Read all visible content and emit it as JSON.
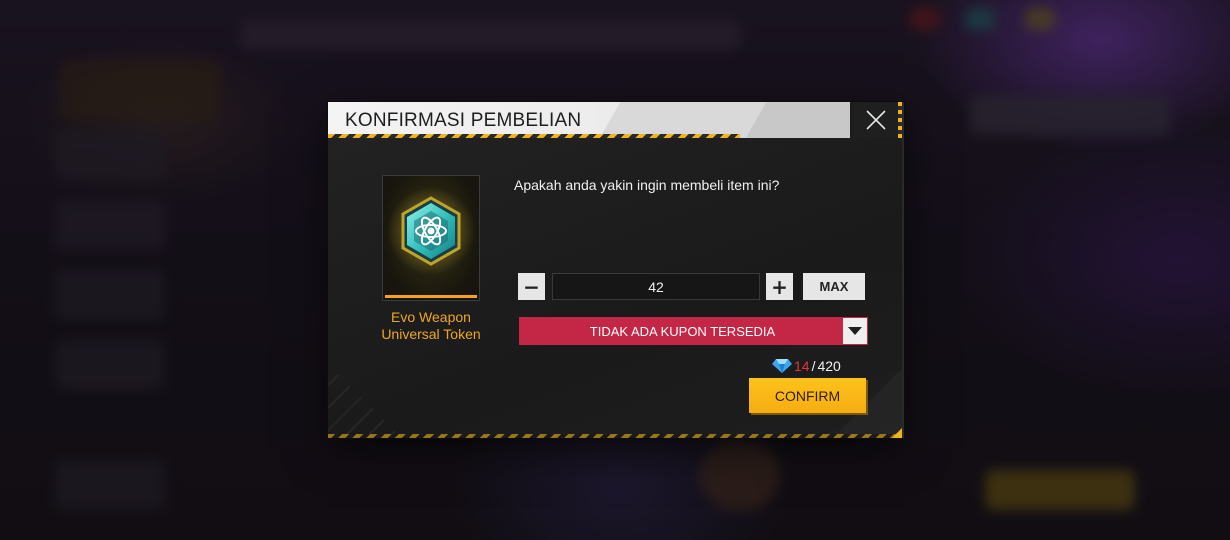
{
  "dialog": {
    "title": "KONFIRMASI PEMBELIAN",
    "question": "Apakah anda yakin ingin membeli item ini?"
  },
  "item": {
    "name_line1": "Evo Weapon",
    "name_line2": "Universal Token",
    "icon": "atom-hexagon-token-icon"
  },
  "quantity": {
    "minus_label": "−",
    "value": "42",
    "plus_label": "+",
    "max_label": "MAX"
  },
  "coupon": {
    "label": "TIDAK ADA KUPON TERSEDIA",
    "icon": "dropdown-arrow-icon"
  },
  "price": {
    "currency_icon": "diamond-icon",
    "owned": "14",
    "separator": "/",
    "required": "420"
  },
  "confirm_label": "CONFIRM",
  "colors": {
    "accent_gold": "#f2b21d",
    "coupon_red": "#c42646",
    "item_name": "#f0a61f",
    "insufficient_red": "#e5353a",
    "token_cyan": "#3fd6d2"
  }
}
